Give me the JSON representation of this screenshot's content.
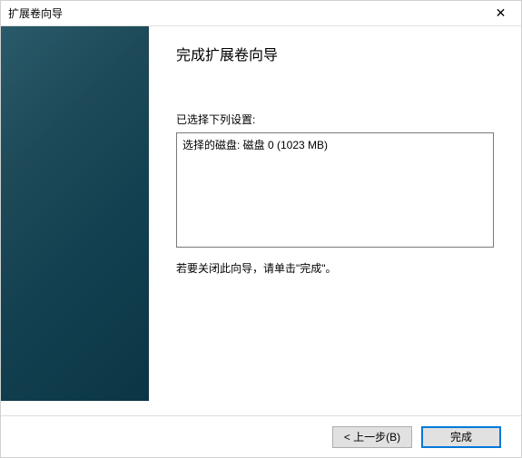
{
  "titlebar": {
    "title": "扩展卷向导"
  },
  "main": {
    "heading": "完成扩展卷向导",
    "selected_label": "已选择下列设置:",
    "settings_text": "选择的磁盘: 磁盘 0 (1023 MB)",
    "hint": "若要关闭此向导，请单击\"完成\"。"
  },
  "buttons": {
    "back": "< 上一步(B)",
    "finish": "完成"
  }
}
